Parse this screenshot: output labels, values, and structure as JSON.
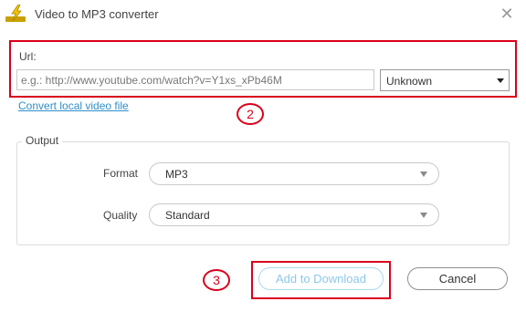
{
  "window": {
    "title": "Video to MP3 converter",
    "close_glyph": "✕",
    "icon": "lightning-app-icon"
  },
  "url_section": {
    "label": "Url:",
    "input_value": "",
    "input_placeholder": "e.g.: http://www.youtube.com/watch?v=Y1xs_xPb46M",
    "type_select_value": "Unknown",
    "convert_local_link": "Convert local video file"
  },
  "annotations": {
    "step_2": "2",
    "step_3": "3",
    "highlight_color": "#d9001b"
  },
  "output": {
    "legend": "Output",
    "format_label": "Format",
    "format_value": "MP3",
    "quality_label": "Quality",
    "quality_value": "Standard"
  },
  "buttons": {
    "add_label": "Add to Download",
    "cancel_label": "Cancel"
  },
  "colors": {
    "link": "#2f8fc9",
    "add_button_text": "#8ec8e8",
    "add_button_border": "#a9d8ee"
  }
}
